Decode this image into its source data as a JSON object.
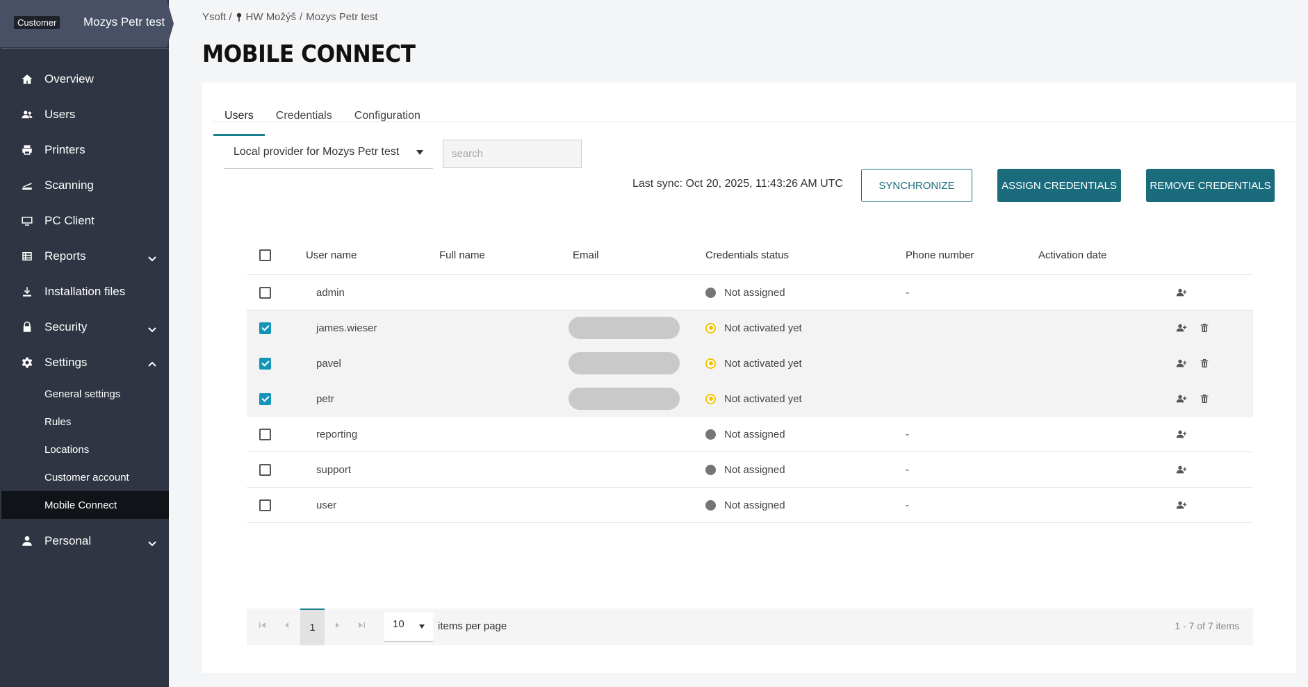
{
  "customer": {
    "badge": "Customer",
    "name": "Mozys Petr test"
  },
  "sidebar": {
    "items": [
      {
        "label": "Overview",
        "icon": "home-icon"
      },
      {
        "label": "Users",
        "icon": "users-icon"
      },
      {
        "label": "Printers",
        "icon": "printer-icon"
      },
      {
        "label": "Scanning",
        "icon": "scanner-icon"
      },
      {
        "label": "PC Client",
        "icon": "monitor-icon"
      },
      {
        "label": "Reports",
        "icon": "reports-icon"
      },
      {
        "label": "Installation files",
        "icon": "download-icon"
      },
      {
        "label": "Security",
        "icon": "lock-icon"
      },
      {
        "label": "Settings",
        "icon": "gear-icon"
      },
      {
        "label": "Personal",
        "icon": "person-icon"
      }
    ],
    "settings_sub": [
      {
        "label": "General settings"
      },
      {
        "label": "Rules"
      },
      {
        "label": "Locations"
      },
      {
        "label": "Customer account"
      },
      {
        "label": "Mobile Connect"
      }
    ]
  },
  "breadcrumb": {
    "root": "Ysoft /",
    "location": "HW Možýš",
    "sep": "/",
    "current": "Mozys Petr test"
  },
  "page_title": "MOBILE CONNECT",
  "tabs": [
    {
      "label": "Users"
    },
    {
      "label": "Credentials"
    },
    {
      "label": "Configuration"
    }
  ],
  "toolbar": {
    "provider": "Local provider for Mozys Petr test",
    "search_placeholder": "search",
    "last_sync": "Last sync: Oct 20, 2025, 11:43:26 AM UTC",
    "sync_label": "SYNCHRONIZE",
    "assign_label": "ASSIGN CREDENTIALS",
    "remove_label": "REMOVE CREDENTIALS"
  },
  "table": {
    "headers": {
      "username": "User name",
      "fullname": "Full name",
      "email": "Email",
      "status": "Credentials status",
      "phone": "Phone number",
      "activation": "Activation date"
    },
    "rows": [
      {
        "username": "admin",
        "status": "Not assigned",
        "phone": "-",
        "checked": false,
        "state": "gray"
      },
      {
        "username": "james.wieser",
        "status": "Not activated yet",
        "phone": "",
        "checked": true,
        "state": "yellow"
      },
      {
        "username": "pavel",
        "status": "Not activated yet",
        "phone": "",
        "checked": true,
        "state": "yellow"
      },
      {
        "username": "petr",
        "status": "Not activated yet",
        "phone": "",
        "checked": true,
        "state": "yellow"
      },
      {
        "username": "reporting",
        "status": "Not assigned",
        "phone": "-",
        "checked": false,
        "state": "gray"
      },
      {
        "username": "support",
        "status": "Not assigned",
        "phone": "-",
        "checked": false,
        "state": "gray"
      },
      {
        "username": "user",
        "status": "Not assigned",
        "phone": "-",
        "checked": false,
        "state": "gray"
      }
    ]
  },
  "pager": {
    "page": "1",
    "size": "10",
    "size_label": "items per page",
    "info": "1 - 7 of 7 items"
  },
  "colors": {
    "sidebar": "#2f3542",
    "accent": "#1a6c7d",
    "pending": "#f3c300",
    "unassigned": "#757575"
  }
}
